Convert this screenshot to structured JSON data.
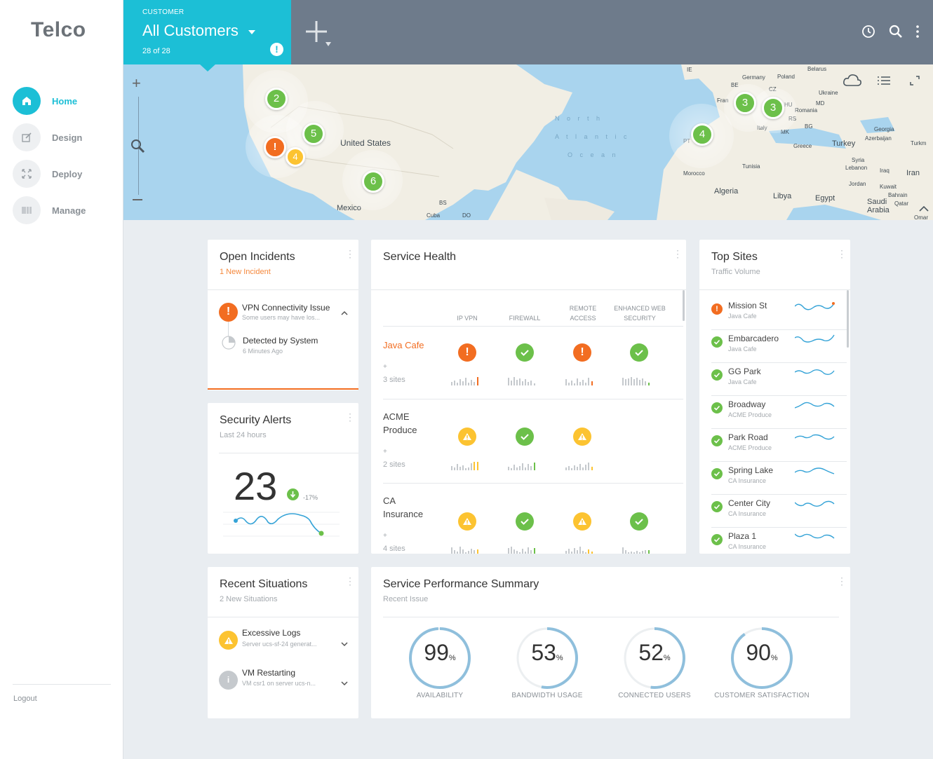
{
  "app": {
    "logo": "Telco"
  },
  "nav": [
    {
      "label": "Home",
      "icon": "home-icon",
      "active": true
    },
    {
      "label": "Design",
      "icon": "design-icon"
    },
    {
      "label": "Deploy",
      "icon": "deploy-icon"
    },
    {
      "label": "Manage",
      "icon": "manage-icon"
    }
  ],
  "logout": "Logout",
  "customer": {
    "caption": "CUSTOMER",
    "title": "All Customers",
    "count": "28 of 28",
    "alert": "!"
  },
  "map": {
    "labels": [
      "United States",
      "Mexico",
      "BS",
      "Cuba",
      "DO",
      "IE",
      "Germany",
      "Poland",
      "Belarus",
      "BE",
      "CZ",
      "Ukraine",
      "Fran",
      "HU",
      "MD",
      "Romania",
      "RS",
      "BG",
      "MK",
      "Italy",
      "Greece",
      "Turkey",
      "Georgia",
      "Azerbaijan",
      "Turkm",
      "PT",
      "Morocco",
      "Algeria",
      "Tunisia",
      "Libya",
      "Egypt",
      "Syria",
      "Lebanon",
      "Iraq",
      "Iran",
      "Jordan",
      "Kuwait",
      "Bahrain",
      "Qatar",
      "Saudi Arabia",
      "Omar",
      "North Atlantic Ocean"
    ],
    "clusters": [
      {
        "value": "2",
        "status": "ok"
      },
      {
        "value": "5",
        "status": "ok"
      },
      {
        "value": "!",
        "status": "error"
      },
      {
        "value": "4",
        "status": "warning"
      },
      {
        "value": "6",
        "status": "ok"
      },
      {
        "value": "4",
        "status": "ok"
      },
      {
        "value": "3",
        "status": "ok"
      },
      {
        "value": "3",
        "status": "ok"
      }
    ]
  },
  "incidents": {
    "title": "Open Incidents",
    "subtitle": "1 New Incident",
    "item": {
      "title": "VPN Connectivity Issue",
      "desc": "Some users may have los...",
      "detected": "Detected by System",
      "time": "6 Minutes Ago"
    }
  },
  "security": {
    "title": "Security Alerts",
    "subtitle": "Last 24 hours",
    "count": "23",
    "change": "-17%"
  },
  "situations": {
    "title": "Recent Situations",
    "subtitle": "2 New Situations",
    "items": [
      {
        "title": "Excessive Logs",
        "desc": "Server ucs-sf-24 generat...",
        "icon": "warning-icon"
      },
      {
        "title": "VM Restarting",
        "desc": "VM csr1 on server ucs-n...",
        "icon": "info-icon"
      }
    ]
  },
  "health": {
    "title": "Service Health",
    "columns": [
      "IP VPN",
      "FIREWALL",
      "REMOTE\nACCESS",
      "ENHANCED WEB\nSECURITY"
    ],
    "rows": [
      {
        "name": "Java Cafe",
        "plus": "+",
        "sites": "3 sites",
        "status": [
          "error",
          "ok",
          "error",
          "ok"
        ]
      },
      {
        "name": "ACME\nProduce",
        "plus": "+",
        "sites": "2 sites",
        "status": [
          "warning",
          "ok",
          "warning",
          ""
        ]
      },
      {
        "name": "CA\nInsurance",
        "plus": "+",
        "sites": "4 sites",
        "status": [
          "warning",
          "ok",
          "warning",
          "ok"
        ]
      }
    ]
  },
  "topsites": {
    "title": "Top Sites",
    "subtitle": "Traffic Volume",
    "items": [
      {
        "name": "Mission St",
        "customer": "Java Cafe",
        "status": "error"
      },
      {
        "name": "Embarcadero",
        "customer": "Java Cafe",
        "status": "ok"
      },
      {
        "name": "GG Park",
        "customer": "Java Cafe",
        "status": "ok"
      },
      {
        "name": "Broadway",
        "customer": "ACME Produce",
        "status": "ok"
      },
      {
        "name": "Park Road",
        "customer": "ACME Produce",
        "status": "ok"
      },
      {
        "name": "Spring Lake",
        "customer": "CA Insurance",
        "status": "ok"
      },
      {
        "name": "Center City",
        "customer": "CA Insurance",
        "status": "ok"
      },
      {
        "name": "Plaza 1",
        "customer": "CA Insurance",
        "status": "ok"
      }
    ]
  },
  "performance": {
    "title": "Service Performance Summary",
    "subtitle": "Recent Issue",
    "gauges": [
      {
        "value": 99,
        "unit": "%",
        "label": "AVAILABILITY"
      },
      {
        "value": 53,
        "unit": "%",
        "label": "BANDWIDTH USAGE"
      },
      {
        "value": 52,
        "unit": "%",
        "label": "CONNECTED USERS"
      },
      {
        "value": 90,
        "unit": "%",
        "label": "CUSTOMER SATISFACTION"
      }
    ]
  },
  "colors": {
    "accent": "#1cbfd6",
    "ok": "#6cc04a",
    "error": "#f26d21",
    "warning": "#fcc331",
    "gauge": "#8fbfdc"
  }
}
